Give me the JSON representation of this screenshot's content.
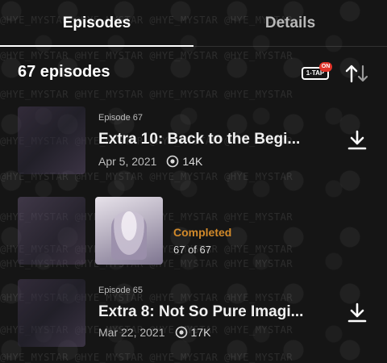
{
  "tabs": [
    {
      "label": "Episodes",
      "active": true
    },
    {
      "label": "Details",
      "active": false
    }
  ],
  "list_header": {
    "episode_count": "67 episodes",
    "onetap_label": "1-TAP",
    "onetap_badge": "ON",
    "sort_icon": "sort-arrows-icon"
  },
  "watermark_text": "@HYE_MYSTAR @HYE_MYSTAR @HYE_MYSTAR @HYE_MYSTAR",
  "episodes": [
    {
      "episode_label": "Episode 67",
      "title": "Extra 10: Back to the Begi...",
      "date": "Apr 5, 2021",
      "views": "14K",
      "icon": "download-icon"
    },
    {
      "episode_label": "Episode 65",
      "title": "Extra 8: Not So Pure Imagi...",
      "date": "Mar 22, 2021",
      "views": "17K",
      "icon": "download-icon"
    }
  ],
  "featured": {
    "status": "Completed",
    "progress": "67 of 67"
  },
  "colors": {
    "background": "#141414",
    "completed": "#d28a2a",
    "onetap_badge": "#e0342a"
  }
}
